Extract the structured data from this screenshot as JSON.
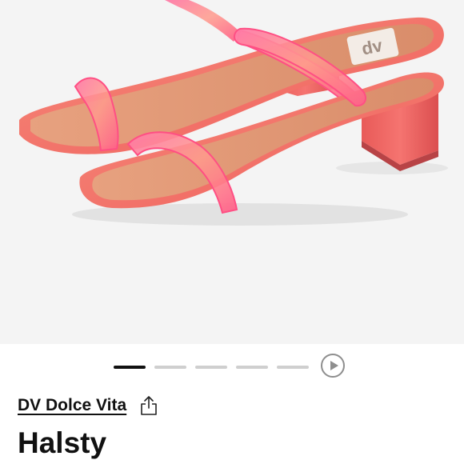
{
  "product": {
    "image_alt": "Pink translucent two-strap block heel sandals",
    "insole_logo_text": "dv",
    "brand": "DV Dolce Vita",
    "title": "Halsty"
  },
  "carousel": {
    "slide_count": 5,
    "active_index": 0,
    "play_icon": "play-circle-icon"
  },
  "share": {
    "icon": "share-icon"
  },
  "colors": {
    "sandal_pink": "#f26a67",
    "strap_neon": "#ff5f8f",
    "background": "#f4f4f4",
    "indicator_active": "#111111",
    "indicator_inactive": "#cfcfcf"
  }
}
